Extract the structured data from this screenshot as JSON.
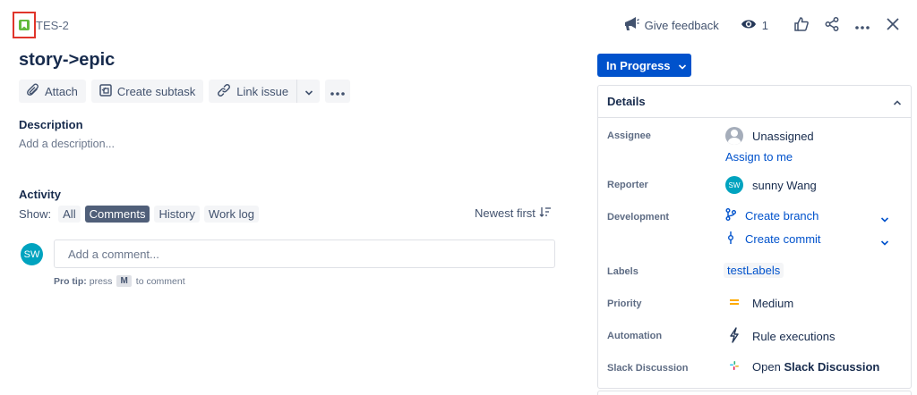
{
  "header": {
    "issue_key": "TES-2",
    "feedback_label": "Give feedback",
    "watch_count": "1"
  },
  "issue": {
    "title": "story->epic"
  },
  "toolbar": {
    "attach_label": "Attach",
    "create_subtask_label": "Create subtask",
    "link_issue_label": "Link issue"
  },
  "description": {
    "heading": "Description",
    "placeholder": "Add a description..."
  },
  "activity": {
    "heading": "Activity",
    "show_label": "Show:",
    "filters": [
      "All",
      "Comments",
      "History",
      "Work log"
    ],
    "active_filter": "Comments",
    "sort_label": "Newest first",
    "comment_avatar": "SW",
    "comment_placeholder": "Add a comment...",
    "protip_bold": "Pro tip:",
    "protip_pre": "press",
    "protip_key": "M",
    "protip_post": "to comment"
  },
  "status": {
    "label": "In Progress"
  },
  "details": {
    "title": "Details",
    "assignee_label": "Assignee",
    "assignee_value": "Unassigned",
    "assign_to_me": "Assign to me",
    "reporter_label": "Reporter",
    "reporter_avatar": "SW",
    "reporter_value": "sunny Wang",
    "development_label": "Development",
    "create_branch": "Create branch",
    "create_commit": "Create commit",
    "labels_label": "Labels",
    "labels_value": "testLabels",
    "priority_label": "Priority",
    "priority_value": "Medium",
    "automation_label": "Automation",
    "automation_value": "Rule executions",
    "slack_label": "Slack Discussion",
    "slack_open": "Open",
    "slack_bold": "Slack Discussion"
  },
  "colors": {
    "primary": "#0052cc",
    "story_green": "#63ba3c",
    "highlight_red": "#e0352b",
    "priority_orange": "#ffab00",
    "avatar_teal": "#00a3bf"
  },
  "icons": [
    "story-icon",
    "megaphone-icon",
    "eye-icon",
    "thumbs-up-icon",
    "share-icon",
    "more-icon",
    "close-icon",
    "paperclip-icon",
    "subtask-icon",
    "link-icon",
    "chevron-down-icon",
    "sort-icon",
    "chevron-up-icon",
    "person-icon",
    "branch-icon",
    "commit-icon",
    "priority-medium-icon",
    "lightning-icon",
    "slack-icon"
  ]
}
